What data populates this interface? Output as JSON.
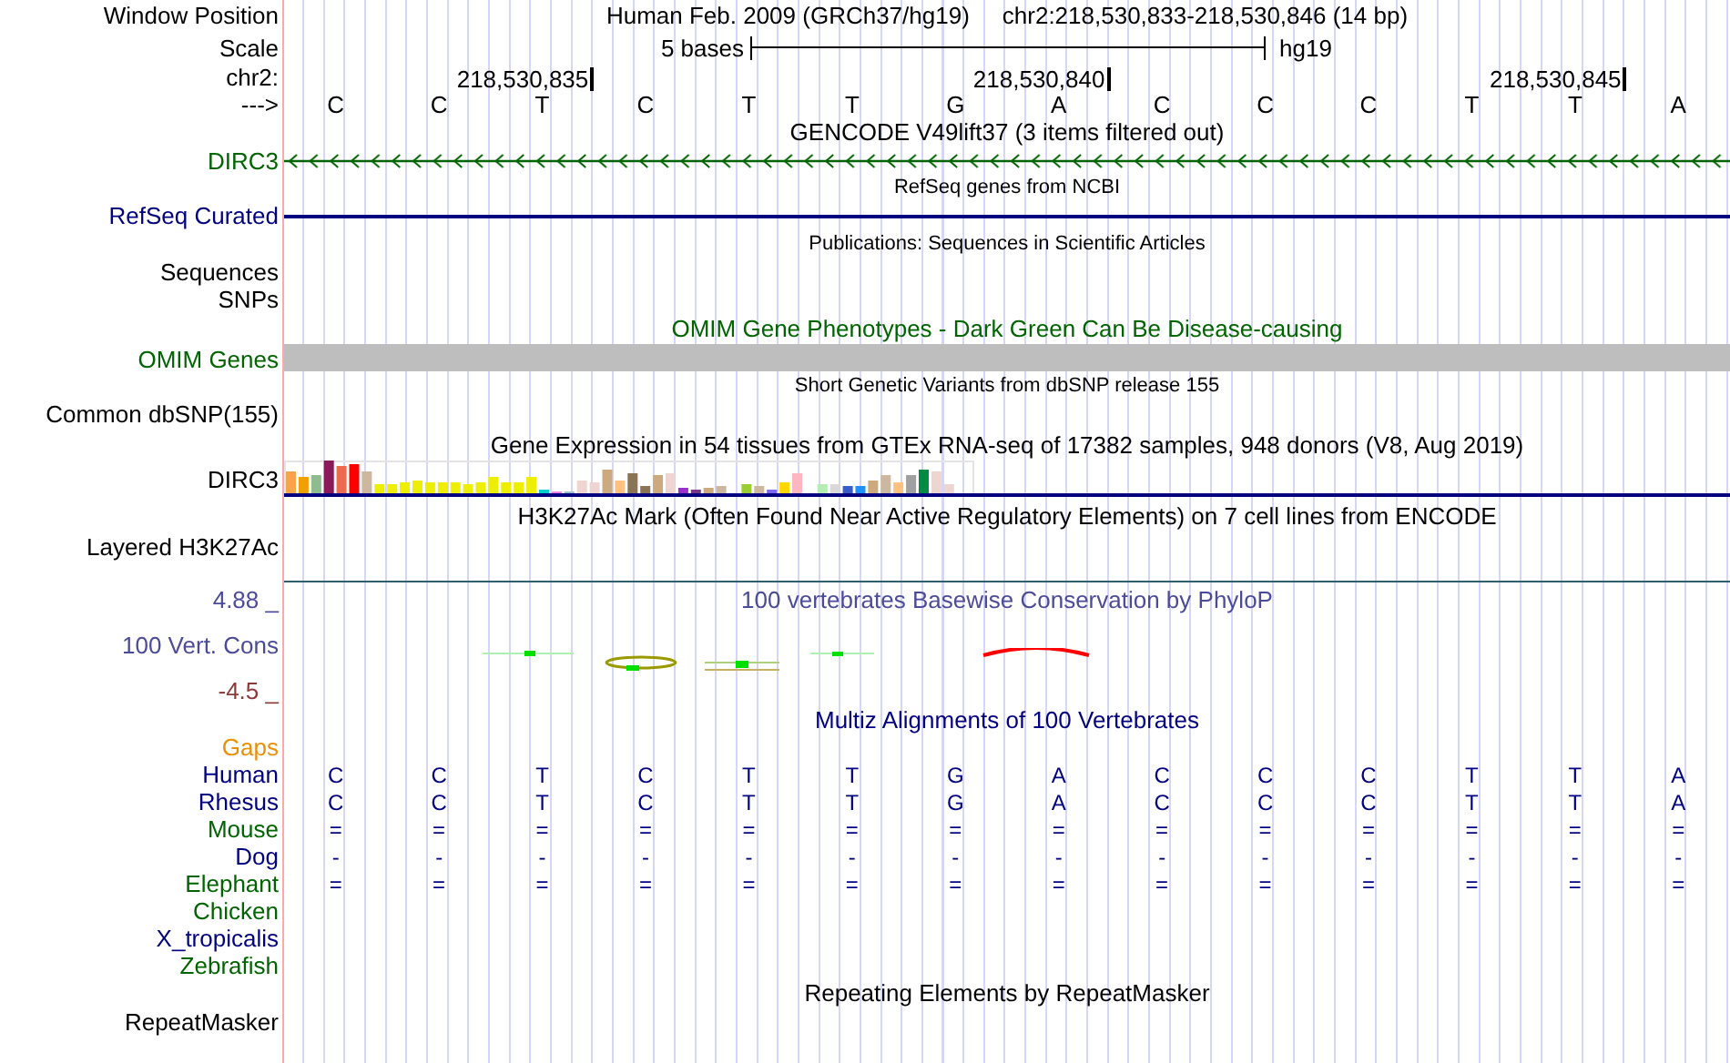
{
  "header": {
    "label": "Window Position",
    "assembly": "Human Feb. 2009 (GRCh37/hg19)",
    "range": "chr2:218,530,833-218,530,846 (14 bp)"
  },
  "scale": {
    "label": "Scale",
    "span": "5 bases",
    "db": "hg19"
  },
  "ruler": {
    "label": "chr2:",
    "strand_label": "--->",
    "bases": [
      {
        "letter": "C"
      },
      {
        "letter": "C"
      },
      {
        "letter": "T",
        "tick": "218,530,835"
      },
      {
        "letter": "C"
      },
      {
        "letter": "T"
      },
      {
        "letter": "T"
      },
      {
        "letter": "G"
      },
      {
        "letter": "A",
        "tick": "218,530,840"
      },
      {
        "letter": "C"
      },
      {
        "letter": "C"
      },
      {
        "letter": "C"
      },
      {
        "letter": "T"
      },
      {
        "letter": "T",
        "tick": "218,530,845"
      },
      {
        "letter": "A"
      }
    ]
  },
  "tracks": [
    {
      "kind": "gene",
      "title": "GENCODE V49lift37 (3 items filtered out)",
      "labels": [
        "DIRC3"
      ]
    },
    {
      "kind": "line",
      "title": "RefSeq genes from NCBI",
      "labels": [
        "RefSeq Curated"
      ]
    },
    {
      "kind": "empty",
      "title": "Publications: Sequences in Scientific Articles",
      "labels": [
        "Sequences",
        "SNPs"
      ]
    },
    {
      "kind": "bar",
      "title": "OMIM Gene Phenotypes - Dark Green Can Be Disease-causing",
      "labels": [
        "OMIM Genes"
      ]
    },
    {
      "kind": "empty",
      "title": "Short Genetic Variants from dbSNP release 155",
      "labels": [
        "Common dbSNP(155)"
      ]
    },
    {
      "kind": "expression",
      "title": "Gene Expression in 54 tissues from GTEx RNA-seq of 17382 samples, 948 donors (V8, Aug 2019)",
      "labels": [
        "DIRC3"
      ]
    },
    {
      "kind": "layered",
      "title": "H3K27Ac Mark (Often Found Near Active Regulatory Elements) on 7 cell lines from ENCODE",
      "labels": [
        "Layered H3K27Ac"
      ]
    }
  ],
  "phylop": {
    "title": "100 vertebrates Basewise Conservation by PhyloP",
    "label": "100 Vert. Cons",
    "max": "4.88 _",
    "min": "-4.5 _"
  },
  "multiz": {
    "title": "Multiz Alignments of 100 Vertebrates",
    "gaps_label": "Gaps",
    "species": [
      {
        "name": "Human",
        "color": "#000080",
        "cells": [
          "C",
          "C",
          "T",
          "C",
          "T",
          "T",
          "G",
          "A",
          "C",
          "C",
          "C",
          "T",
          "T",
          "A"
        ]
      },
      {
        "name": "Rhesus",
        "color": "#000080",
        "cells": [
          "C",
          "C",
          "T",
          "C",
          "T",
          "T",
          "G",
          "A",
          "C",
          "C",
          "C",
          "T",
          "T",
          "A"
        ]
      },
      {
        "name": "Mouse",
        "color": "#006400",
        "cells": [
          "=",
          "=",
          "=",
          "=",
          "=",
          "=",
          "=",
          "=",
          "=",
          "=",
          "=",
          "=",
          "=",
          "="
        ]
      },
      {
        "name": "Dog",
        "color": "#000080",
        "cells": [
          "-",
          "-",
          "-",
          "-",
          "-",
          "-",
          "-",
          "-",
          "-",
          "-",
          "-",
          "-",
          "-",
          "-"
        ]
      },
      {
        "name": "Elephant",
        "color": "#006400",
        "cells": [
          "=",
          "=",
          "=",
          "=",
          "=",
          "=",
          "=",
          "=",
          "=",
          "=",
          "=",
          "=",
          "=",
          "="
        ]
      },
      {
        "name": "Chicken",
        "color": "#006400"
      },
      {
        "name": "X_tropicalis",
        "color": "#000080"
      },
      {
        "name": "Zebrafish",
        "color": "#006400"
      }
    ]
  },
  "repeatmasker": {
    "title": "Repeating Elements by RepeatMasker",
    "label": "RepeatMasker"
  }
}
